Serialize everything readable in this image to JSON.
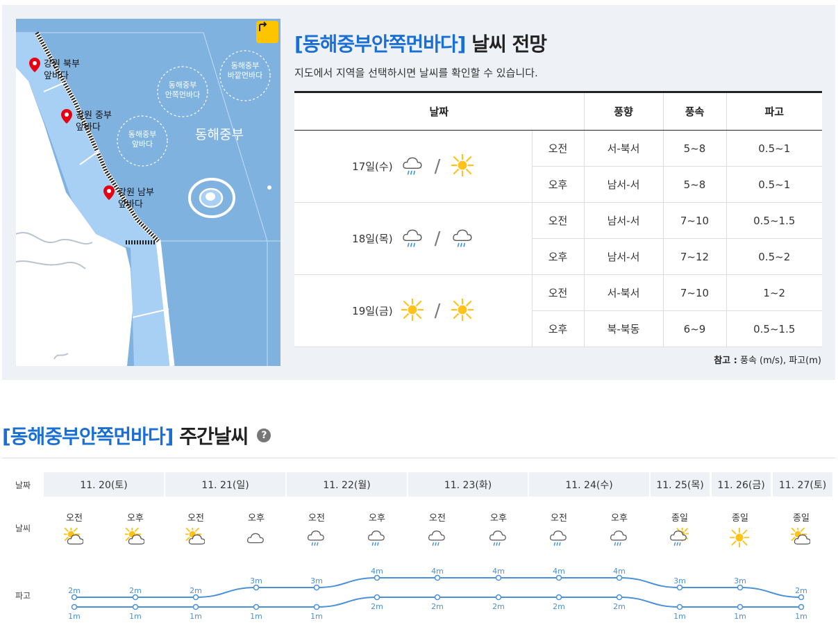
{
  "map": {
    "pins": [
      {
        "label": "강원 북부\n앞바다"
      },
      {
        "label": "강원 중부\n앞바다"
      },
      {
        "label": "강원 남부\n앞바다"
      }
    ],
    "zones": [
      {
        "label": "동해중부\n바깥먼바다"
      },
      {
        "label": "동해중부\n안쪽먼바다"
      },
      {
        "label": "동해중부\n앞바다"
      }
    ],
    "sea_label": "동해중부",
    "colors": {
      "sea": "#80b2e0",
      "nearshore": "#a8d0f5",
      "pin": "#e60012",
      "button": "#ffc400"
    }
  },
  "forecast": {
    "title_region": "[동해중부안쪽먼바다]",
    "title_suffix": "날씨 전망",
    "description": "지도에서 지역을 선택하시면 날씨를 확인할 수 있습니다.",
    "headers": [
      "날짜",
      "풍향",
      "풍속",
      "파고"
    ],
    "days": [
      {
        "date": "17일(수)",
        "icon_am": "rain-cloud-icon",
        "icon_pm": "sun-icon",
        "rows": [
          {
            "period": "오전",
            "wind_dir": "서-북서",
            "wind_speed": "5~8",
            "wave": "0.5~1"
          },
          {
            "period": "오후",
            "wind_dir": "남서-서",
            "wind_speed": "5~8",
            "wave": "0.5~1"
          }
        ]
      },
      {
        "date": "18일(목)",
        "icon_am": "rain-cloud-icon",
        "icon_pm": "rain-cloud-icon",
        "rows": [
          {
            "period": "오전",
            "wind_dir": "남서-서",
            "wind_speed": "7~10",
            "wave": "0.5~1.5"
          },
          {
            "period": "오후",
            "wind_dir": "남서-서",
            "wind_speed": "7~12",
            "wave": "0.5~2"
          }
        ]
      },
      {
        "date": "19일(금)",
        "icon_am": "sun-icon",
        "icon_pm": "sun-icon",
        "rows": [
          {
            "period": "오전",
            "wind_dir": "서-북서",
            "wind_speed": "7~10",
            "wave": "1~2"
          },
          {
            "period": "오후",
            "wind_dir": "북-북동",
            "wind_speed": "6~9",
            "wave": "0.5~1.5"
          }
        ]
      }
    ],
    "note_label": "참고 :",
    "note_text": "풍속 (m/s), 파고(m)"
  },
  "weekly": {
    "title_region": "[동해중부안쪽먼바다]",
    "title_suffix": "주간날씨",
    "help": "?",
    "row_labels": {
      "date": "날짜",
      "weather": "날씨",
      "wave": "파고"
    },
    "dates": [
      "11. 20(토)",
      "11. 21(일)",
      "11. 22(월)",
      "11. 23(화)",
      "11. 24(수)",
      "11. 25(목)",
      "11. 26(금)",
      "11. 27(토)"
    ],
    "slots": [
      {
        "period": "오전",
        "icon": "partly-cloudy-icon",
        "wave_max": 2,
        "wave_min": 1
      },
      {
        "period": "오후",
        "icon": "partly-cloudy-icon",
        "wave_max": 2,
        "wave_min": 1
      },
      {
        "period": "오전",
        "icon": "partly-cloudy-icon",
        "wave_max": 2,
        "wave_min": 1
      },
      {
        "period": "오후",
        "icon": "cloud-icon",
        "wave_max": 3,
        "wave_min": 1
      },
      {
        "period": "오전",
        "icon": "rain-cloud-icon",
        "wave_max": 3,
        "wave_min": 1
      },
      {
        "period": "오후",
        "icon": "rain-cloud-icon",
        "wave_max": 4,
        "wave_min": 2
      },
      {
        "period": "오전",
        "icon": "rain-cloud-icon",
        "wave_max": 4,
        "wave_min": 2
      },
      {
        "period": "오후",
        "icon": "rain-cloud-icon",
        "wave_max": 4,
        "wave_min": 2
      },
      {
        "period": "오전",
        "icon": "rain-cloud-icon",
        "wave_max": 4,
        "wave_min": 2
      },
      {
        "period": "오후",
        "icon": "rain-cloud-icon",
        "wave_max": 4,
        "wave_min": 2
      },
      {
        "period": "종일",
        "icon": "rain-sun-cloud-icon",
        "wave_max": 3,
        "wave_min": 1
      },
      {
        "period": "종일",
        "icon": "sun-icon",
        "wave_max": 3,
        "wave_min": 1
      },
      {
        "period": "종일",
        "icon": "partly-cloudy-icon",
        "wave_max": 2,
        "wave_min": 1
      }
    ],
    "wave_unit": "m",
    "colors": {
      "accent": "#1a6fd4",
      "wave_line": "#4a90d9",
      "header_bg": "#eef1f5"
    }
  }
}
